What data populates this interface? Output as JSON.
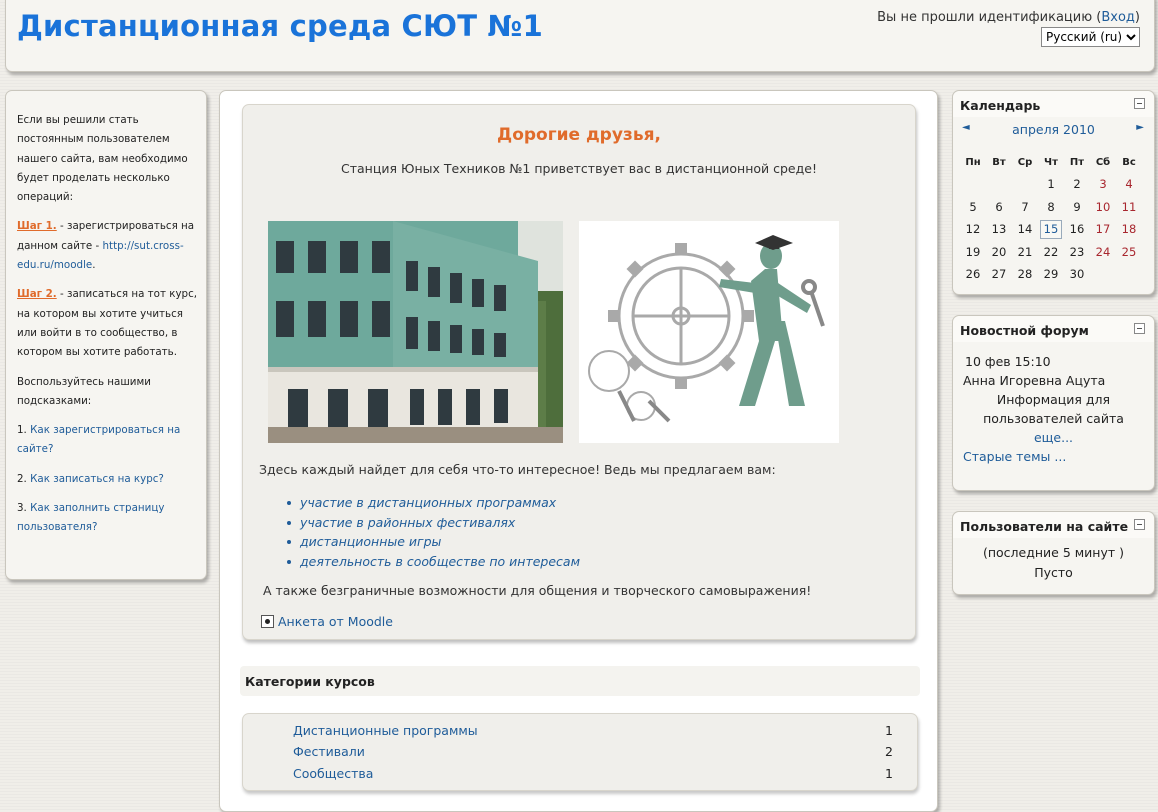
{
  "header": {
    "site_title": "Дистанционная среда СЮТ №1",
    "login_prefix": "Вы не прошли идентификацию (",
    "login_link": "Вход",
    "login_suffix": ")",
    "language": "Русский (ru)"
  },
  "left": {
    "intro": "Если вы решили стать постоянным пользователем нашего сайта, вам необходимо будет проделать несколько операций:",
    "step1_label": "Шаг 1.",
    "step1_text": " - зарегистрироваться на данном сайте -",
    "step1_link": "http://sut.cross-edu.ru/moodle",
    "step1_end": ".",
    "step2_label": "Шаг 2.",
    "step2_text": " - записаться на тот курс, на котором вы хотите учиться или войти в то сообщество, в котором вы хотите работать.",
    "hints_intro": "Воспользуйтесь нашими подсказками:",
    "hints": [
      {
        "num": "1. ",
        "text": "Как зарегистрироваться на сайте?"
      },
      {
        "num": "2. ",
        "text": "Как записаться на курс?"
      },
      {
        "num": "3. ",
        "text": "Как заполнить страницу пользователя?"
      }
    ]
  },
  "welcome": {
    "title": "Дорогие друзья,",
    "subtitle": "Станция Юных Техников №1 приветствует вас в дистанционной среде!",
    "intro": "Здесь каждый найдет для себя что-то интересное! Ведь мы предлагаем вам:",
    "offers": [
      "участие в дистанционных программах",
      "участие в районных фестивалях",
      "дистанционные игры",
      "деятельность в сообществе по интересам"
    ],
    "outro": "А также безграничные возможности для общения и творческого самовыражения!",
    "survey_link": "Анкета от Moodle"
  },
  "categories": {
    "heading": "Категории курсов",
    "items": [
      {
        "name": "Дистанционные программы",
        "count": "1"
      },
      {
        "name": "Фестивали",
        "count": "2"
      },
      {
        "name": "Сообщества",
        "count": "1"
      }
    ]
  },
  "calendar": {
    "title": "Календарь",
    "prev": "◄",
    "next": "►",
    "month": "апреля 2010",
    "weekdays": [
      "Пн",
      "Вт",
      "Ср",
      "Чт",
      "Пт",
      "Сб",
      "Вс"
    ],
    "weeks": [
      [
        "",
        "",
        "",
        "1",
        "2",
        "3",
        "4"
      ],
      [
        "5",
        "6",
        "7",
        "8",
        "9",
        "10",
        "11"
      ],
      [
        "12",
        "13",
        "14",
        "15",
        "16",
        "17",
        "18"
      ],
      [
        "19",
        "20",
        "21",
        "22",
        "23",
        "24",
        "25"
      ],
      [
        "26",
        "27",
        "28",
        "29",
        "30",
        "",
        ""
      ]
    ],
    "today": "15"
  },
  "forum": {
    "title": "Новостной форум",
    "date": "10 фев 15:10",
    "author": "Анна Игоревна Ацута",
    "topic_line1": "Информация для",
    "topic_line2": "пользователей сайта",
    "more": "еще...",
    "old_topics": "Старые темы ..."
  },
  "users": {
    "title": "Пользователи на сайте",
    "period": "(последние 5 минут )",
    "status": "Пусто"
  },
  "colors": {
    "title_blue": "#1a73d9",
    "link": "#1f5c99",
    "accent_orange": "#e06b2b",
    "weekend_red": "#a8262e"
  }
}
